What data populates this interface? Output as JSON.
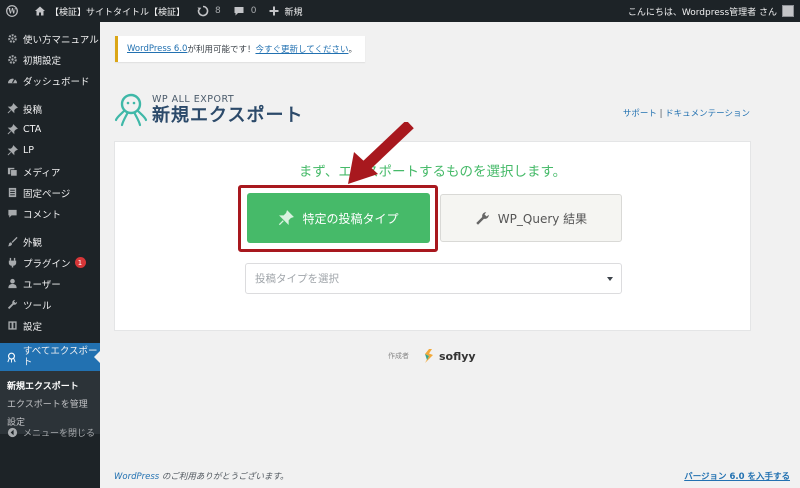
{
  "adminbar": {
    "site_title": "【検証】サイトタイトル【検証】",
    "updates_count": "8",
    "comments_count": "0",
    "new_label": "新規",
    "greeting": "こんにちは、Wordpress管理者 さん"
  },
  "sidebar": {
    "items": [
      {
        "label": "使い方マニュアル"
      },
      {
        "label": "初期設定"
      },
      {
        "label": "ダッシュボード"
      },
      {
        "label": "投稿"
      },
      {
        "label": "CTA"
      },
      {
        "label": "LP"
      },
      {
        "label": "メディア"
      },
      {
        "label": "固定ページ"
      },
      {
        "label": "コメント"
      },
      {
        "label": "外観"
      },
      {
        "label": "プラグイン",
        "badge": "1"
      },
      {
        "label": "ユーザー"
      },
      {
        "label": "ツール"
      },
      {
        "label": "設定"
      },
      {
        "label": "すべてエクスポート"
      }
    ],
    "submenu": [
      "新規エクスポート",
      "エクスポートを管理",
      "設定"
    ],
    "collapse_label": "メニューを閉じる"
  },
  "notice": {
    "version_link": "WordPress 6.0",
    "text": " が利用可能です！",
    "update_link": "今すぐ更新してください",
    "end": "。"
  },
  "header": {
    "logo_small": "WP ALL EXPORT",
    "title": "新規エクスポート",
    "support": "サポート",
    "sep": " | ",
    "docs": "ドキュメンテーション"
  },
  "panel": {
    "heading": "まず、エクスポートするものを選択します。",
    "primary_button": "特定の投稿タイプ",
    "secondary_button": "WP_Query 結果",
    "select_placeholder": "投稿タイプを選択"
  },
  "made_by": {
    "label": "作成者",
    "brand": "soflyy"
  },
  "footer": {
    "wp_link": "WordPress",
    "thanks": " のご利用ありがとうございます。",
    "version": "バージョン 6.0 を入手する"
  },
  "colors": {
    "accent_green": "#46ba69",
    "highlight_red": "#a8181e",
    "wp_blue": "#2271b1",
    "admin_dark": "#1d2327"
  }
}
